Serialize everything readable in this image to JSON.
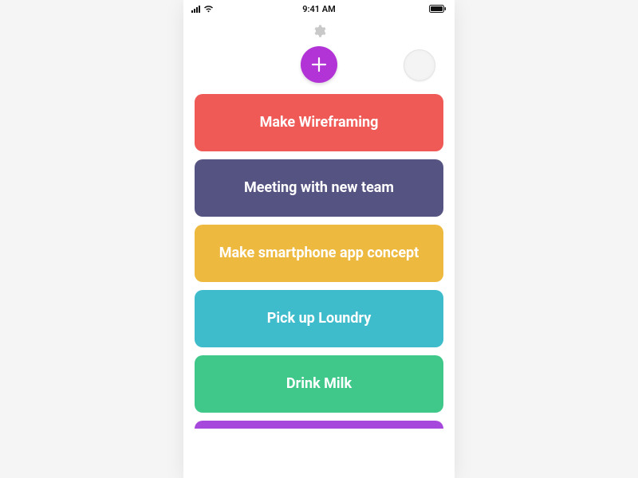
{
  "statusBar": {
    "time": "9:41 AM"
  },
  "colors": {
    "accent": "#b233d6",
    "cardColors": [
      "#ef5a57",
      "#555381",
      "#eeb93f",
      "#3fbccb",
      "#40c88b",
      "#a648db"
    ]
  },
  "tasks": [
    {
      "label": "Make Wireframing"
    },
    {
      "label": "Meeting with new team"
    },
    {
      "label": "Make smartphone app concept"
    },
    {
      "label": "Pick up Loundry"
    },
    {
      "label": "Drink Milk"
    },
    {
      "label": ""
    }
  ]
}
